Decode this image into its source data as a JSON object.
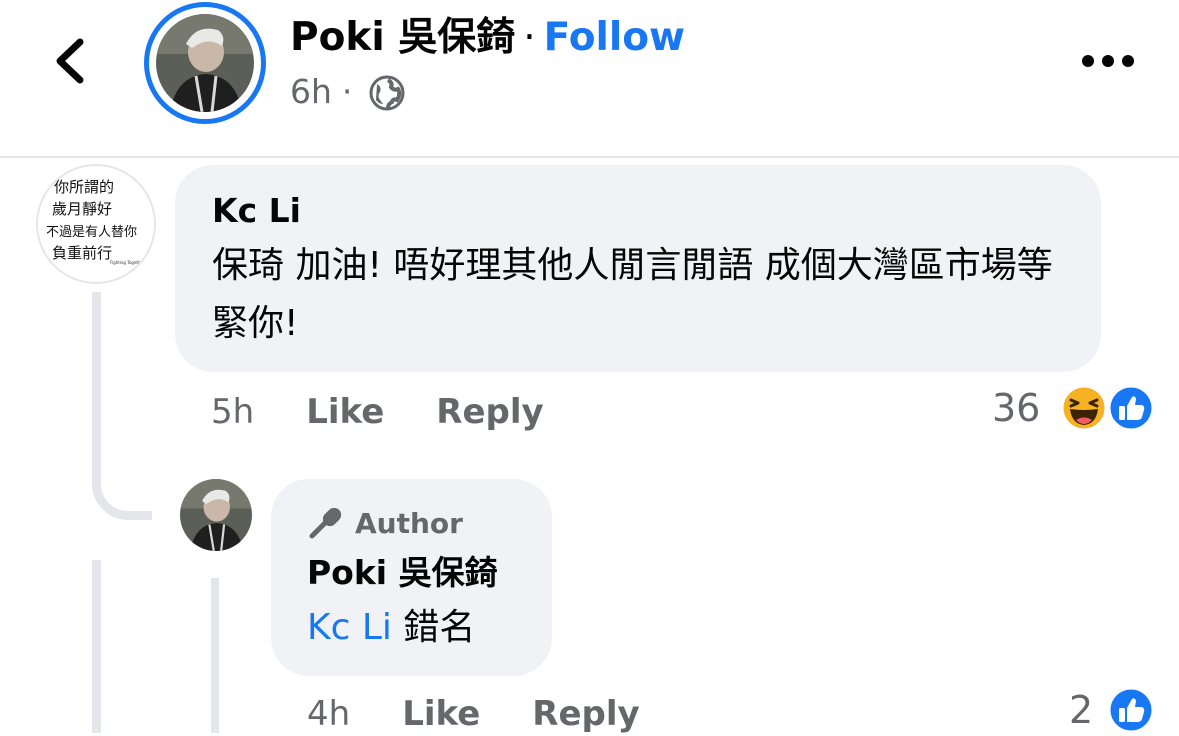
{
  "post_header": {
    "author_name": "Poki 吳保錡",
    "separator": "·",
    "follow_label": "Follow",
    "timestamp": "6h",
    "meta_separator": "·",
    "privacy_icon": "globe-icon",
    "back_icon": "chevron-left-icon",
    "more_icon": "more-horizontal-icon"
  },
  "comments": [
    {
      "author": "Kc Li",
      "text": "保琦 加油! 唔好理其他人閒言閒語 成個大灣區市場等緊你!",
      "time": "5h",
      "like_label": "Like",
      "reply_label": "Reply",
      "reaction_count": "36",
      "reactions": [
        "haha-emoji",
        "like-icon"
      ],
      "avatar_text": [
        "你所謂的",
        "歲月靜好",
        "不過是有人替你",
        "負重前行"
      ],
      "avatar_small_text": "Fighting Together"
    },
    {
      "author_badge": "Author",
      "author": "Poki 吳保錡",
      "mention": "Kc Li",
      "text": "錯名",
      "time": "4h",
      "like_label": "Like",
      "reply_label": "Reply",
      "reaction_count": "2",
      "reactions": [
        "like-icon"
      ]
    }
  ],
  "colors": {
    "accent": "#1877f2",
    "bubble": "#f0f2f5",
    "secondary_text": "#65676b",
    "thread_line": "#e4e6eb"
  }
}
